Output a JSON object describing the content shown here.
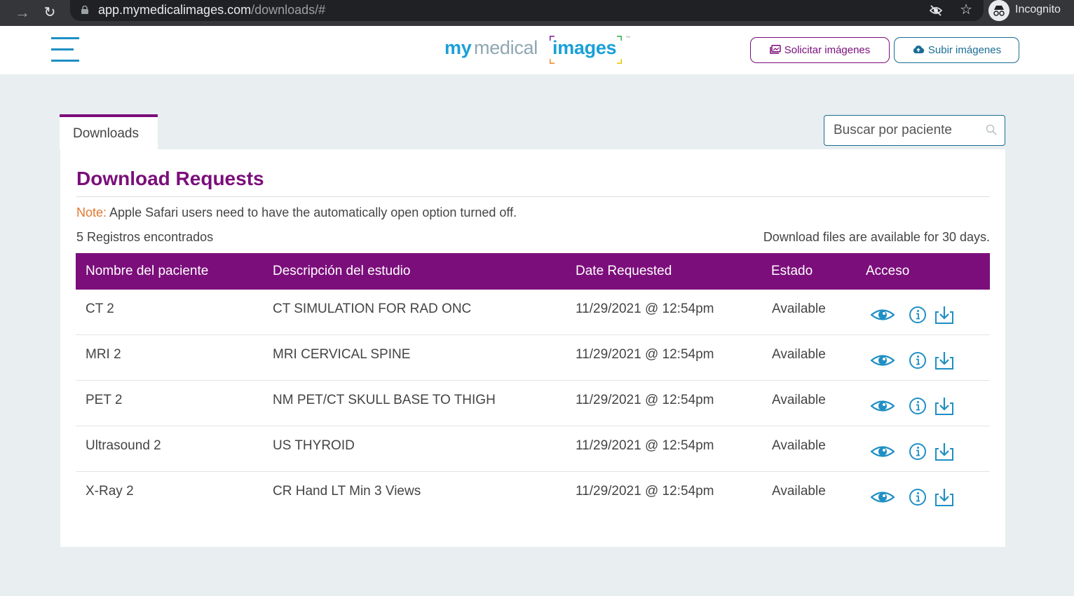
{
  "browser": {
    "url_host": "app.mymedicalimages.com",
    "url_path": "/downloads/#",
    "profile_label": "Incognito",
    "icons": [
      "forward-arrow-icon",
      "reload-icon",
      "lock-icon",
      "eye-off-icon",
      "star-icon",
      "incognito-icon"
    ]
  },
  "header": {
    "logo": {
      "my": "my",
      "medical": "medical",
      "images": "images",
      "tm": "™"
    },
    "request_button": "Solicitar imágenes",
    "upload_button": "Subir imágenes",
    "colors": {
      "brand_purple": "#7b0e7b",
      "brand_blue": "#1aa0d8",
      "upload_border": "#1a6d94"
    }
  },
  "tabs": [
    {
      "label": "Downloads",
      "active": true
    }
  ],
  "search": {
    "placeholder": "Buscar por paciente"
  },
  "main": {
    "title": "Download Requests",
    "note_label": "Note:",
    "note_text": " Apple Safari users need to have the automatically open option turned off.",
    "records_found": "5 Registros encontrados",
    "availability": "Download files are available for 30 days."
  },
  "table": {
    "headers": [
      "Nombre del paciente",
      "Descripción del estudio",
      "Date Requested",
      "Estado",
      "Acceso"
    ],
    "rows": [
      {
        "patient": "CT 2",
        "study": "CT SIMULATION FOR RAD ONC",
        "date": "11/29/2021 @ 12:54pm",
        "status": "Available"
      },
      {
        "patient": "MRI 2",
        "study": "MRI CERVICAL SPINE",
        "date": "11/29/2021 @ 12:54pm",
        "status": "Available"
      },
      {
        "patient": "PET 2",
        "study": "NM PET/CT SKULL BASE TO THIGH",
        "date": "11/29/2021 @ 12:54pm",
        "status": "Available"
      },
      {
        "patient": "Ultrasound 2",
        "study": "US THYROID",
        "date": "11/29/2021 @ 12:54pm",
        "status": "Available"
      },
      {
        "patient": "X-Ray 2",
        "study": "CR Hand LT Min 3 Views",
        "date": "11/29/2021 @ 12:54pm",
        "status": "Available"
      }
    ],
    "access_icons": [
      "eye-icon",
      "info-icon",
      "download-icon"
    ],
    "icon_color": "#1f8fc4"
  }
}
